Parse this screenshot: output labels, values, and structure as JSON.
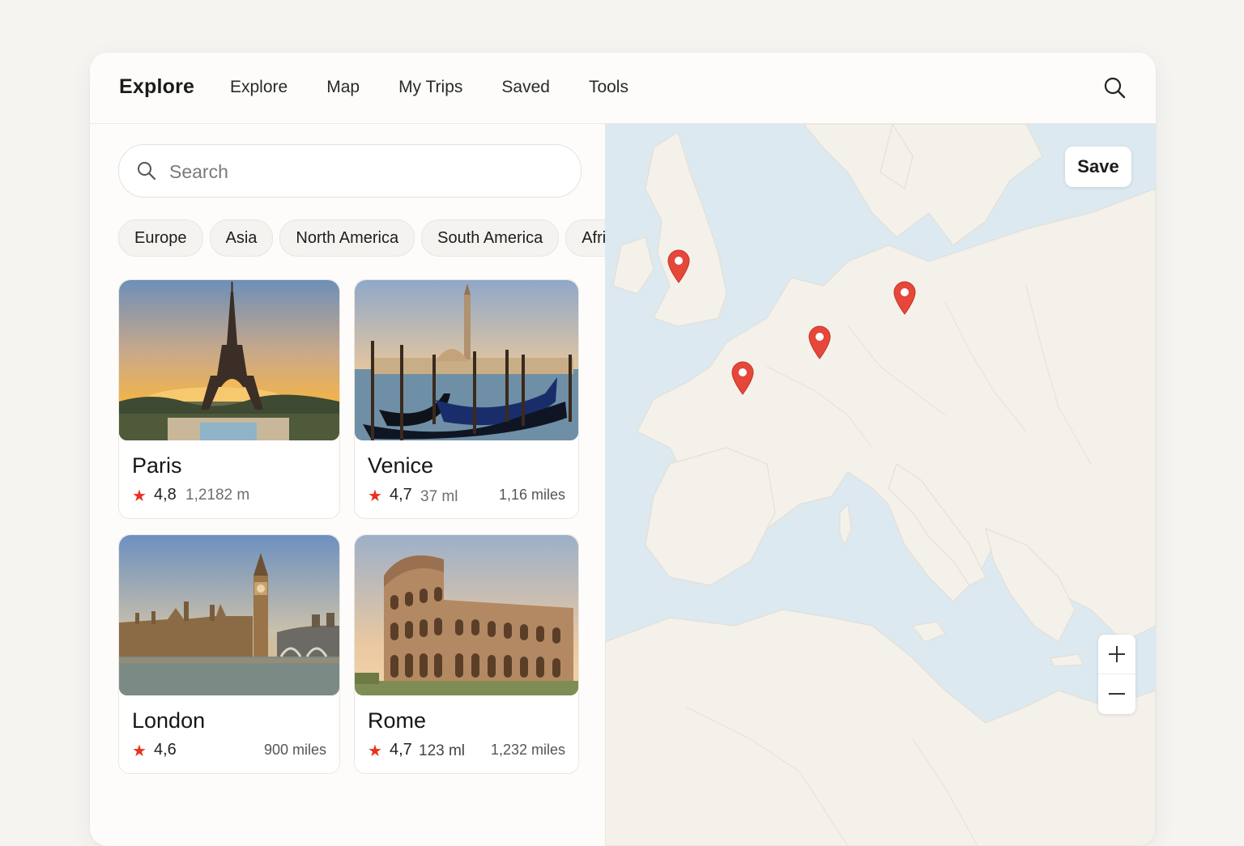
{
  "app": {
    "brand": "Explore",
    "nav": [
      "Explore",
      "Map",
      "My Trips",
      "Saved",
      "Tools"
    ],
    "search_icon": "search-icon"
  },
  "sidebar": {
    "search": {
      "placeholder": "Search",
      "value": "",
      "icon": "search-icon"
    },
    "chips": [
      "Europe",
      "Asia",
      "North America",
      "South America",
      "Afric"
    ],
    "cards": [
      {
        "title": "Paris",
        "rating": "4,8",
        "sub": "1,2182 m",
        "dist": ""
      },
      {
        "title": "Venice",
        "rating": "4,7",
        "sub": "37  ml",
        "dist": "1,16 miles"
      },
      {
        "title": "London",
        "rating": "4,6",
        "sub": "",
        "dist": "900 miles"
      },
      {
        "title": "Rome",
        "rating": "4,7",
        "sub": "123 ml",
        "dist": "1,232 miles"
      }
    ],
    "star_color": "#e8321f"
  },
  "map": {
    "save_label": "Save",
    "zoom_in": "+",
    "zoom_out": "−",
    "pin_color": "#e5473a",
    "water_color": "#dce9f0",
    "land_color": "#f4f1ea",
    "pin_count": 4
  }
}
